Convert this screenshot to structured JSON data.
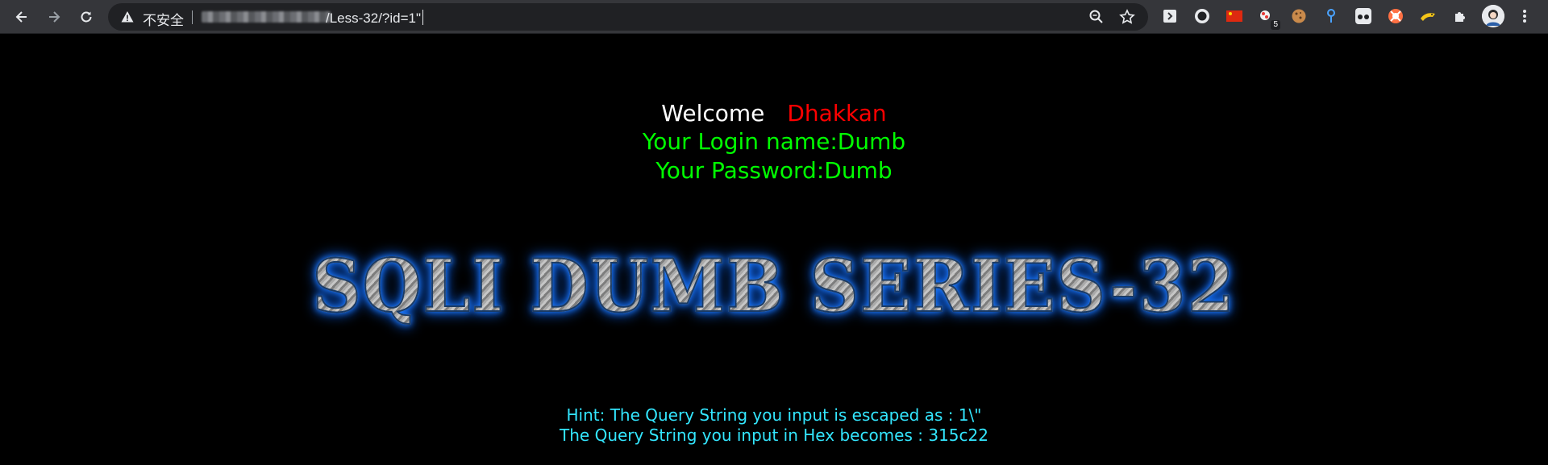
{
  "browser": {
    "security_label": "不安全",
    "url_visible": "/Less-32/?id=1\"",
    "extension_badge": "5",
    "icons": {
      "back": "arrow-left-icon",
      "forward": "arrow-right-icon",
      "reload": "reload-icon",
      "warning": "warning-triangle-icon",
      "zoom": "magnifier-icon",
      "bookmark": "star-icon",
      "extensions": "puzzle-icon",
      "menu": "kebab-menu-icon"
    }
  },
  "page": {
    "welcome": "Welcome",
    "user_name": "Dhakkan",
    "login_line": "Your Login name:Dumb",
    "password_line": "Your Password:Dumb",
    "banner": "SQLI DUMB SERIES-32",
    "hint_escaped": "Hint: The Query String you input is escaped as : 1\\\"",
    "hint_hex": "The Query String you input in Hex becomes : 315c22"
  },
  "colors": {
    "background": "#000000",
    "welcome": "#ffffff",
    "user_name": "#ff0000",
    "credentials": "#00ff00",
    "hint": "#33e6ff",
    "banner_glow": "#1e7bff"
  }
}
